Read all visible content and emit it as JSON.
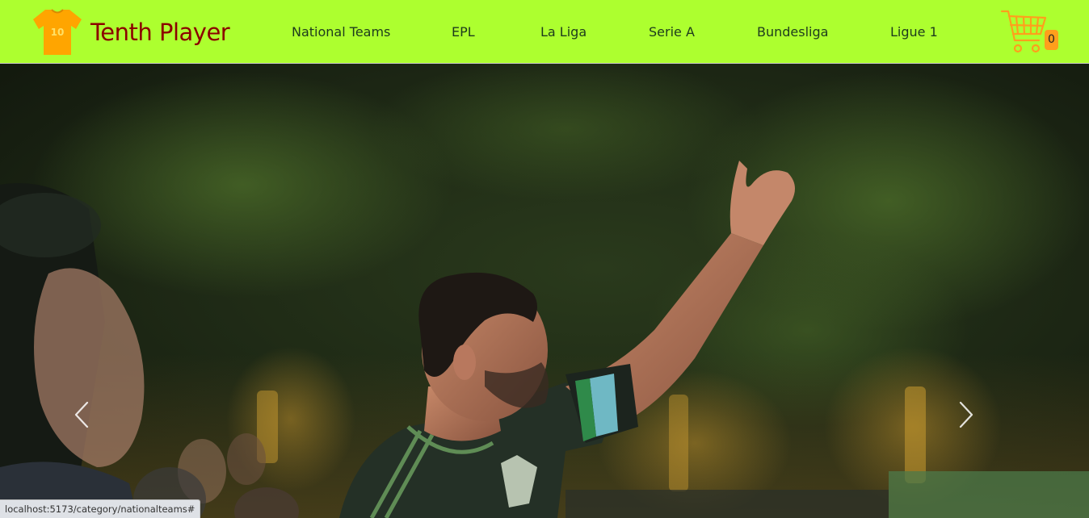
{
  "brand": {
    "name": "Tenth Player",
    "jersey_number": "10",
    "jersey_color": "#ffa500",
    "text_color": "#8b0000"
  },
  "nav": {
    "background": "#adff2f",
    "links": [
      {
        "label": "National Teams"
      },
      {
        "label": "EPL"
      },
      {
        "label": "La Liga"
      },
      {
        "label": "Serie A"
      },
      {
        "label": "Bundesliga"
      },
      {
        "label": "Ligue 1"
      }
    ]
  },
  "cart": {
    "icon": "shopping-cart-icon",
    "count": "0",
    "icon_color": "#ff9f1c"
  },
  "carousel": {
    "slide_icon": "soccer-player-photo",
    "prev_icon": "chevron-left-icon",
    "next_icon": "chevron-right-icon"
  },
  "status_bar": {
    "url": "localhost:5173/category/nationalteams#"
  }
}
